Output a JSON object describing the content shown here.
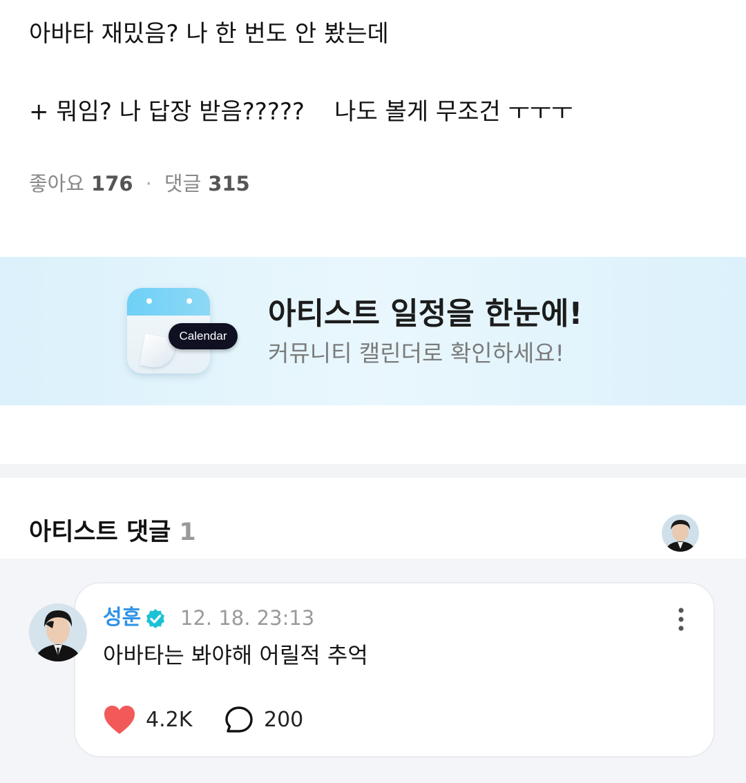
{
  "post": {
    "line1": "아바타 재밌음? 나 한 번도 안 봤는데",
    "line2": "+ 뭐임? 나 답장 받음?????    나도 볼게 무조건 ㅜㅜㅜ"
  },
  "stats": {
    "likes_label": "좋아요",
    "likes_count": "176",
    "separator": "·",
    "comments_label": "댓글",
    "comments_count": "315"
  },
  "banner": {
    "tag": "Calendar",
    "title": "아티스트 일정을 한눈에!",
    "subtitle": "커뮤니티 캘린더로 확인하세요!",
    "icon": "calendar-icon"
  },
  "artist_comments": {
    "title": "아티스트 댓글",
    "count": "1"
  },
  "comment": {
    "author": "성훈",
    "timestamp": "12. 18. 23:13",
    "text": "아바타는 봐야해 어릴적 추억",
    "likes": "4.2K",
    "replies": "200"
  },
  "colors": {
    "accent_blue": "#2f92e6",
    "verified_badge": "#1bc1d6",
    "like_heart": "#f25a5a",
    "banner_bg": "#e3f4fc"
  },
  "icons": {
    "verified": "verified-badge-icon",
    "more": "more-vertical-icon",
    "like": "heart-icon",
    "reply": "speech-bubble-icon"
  }
}
